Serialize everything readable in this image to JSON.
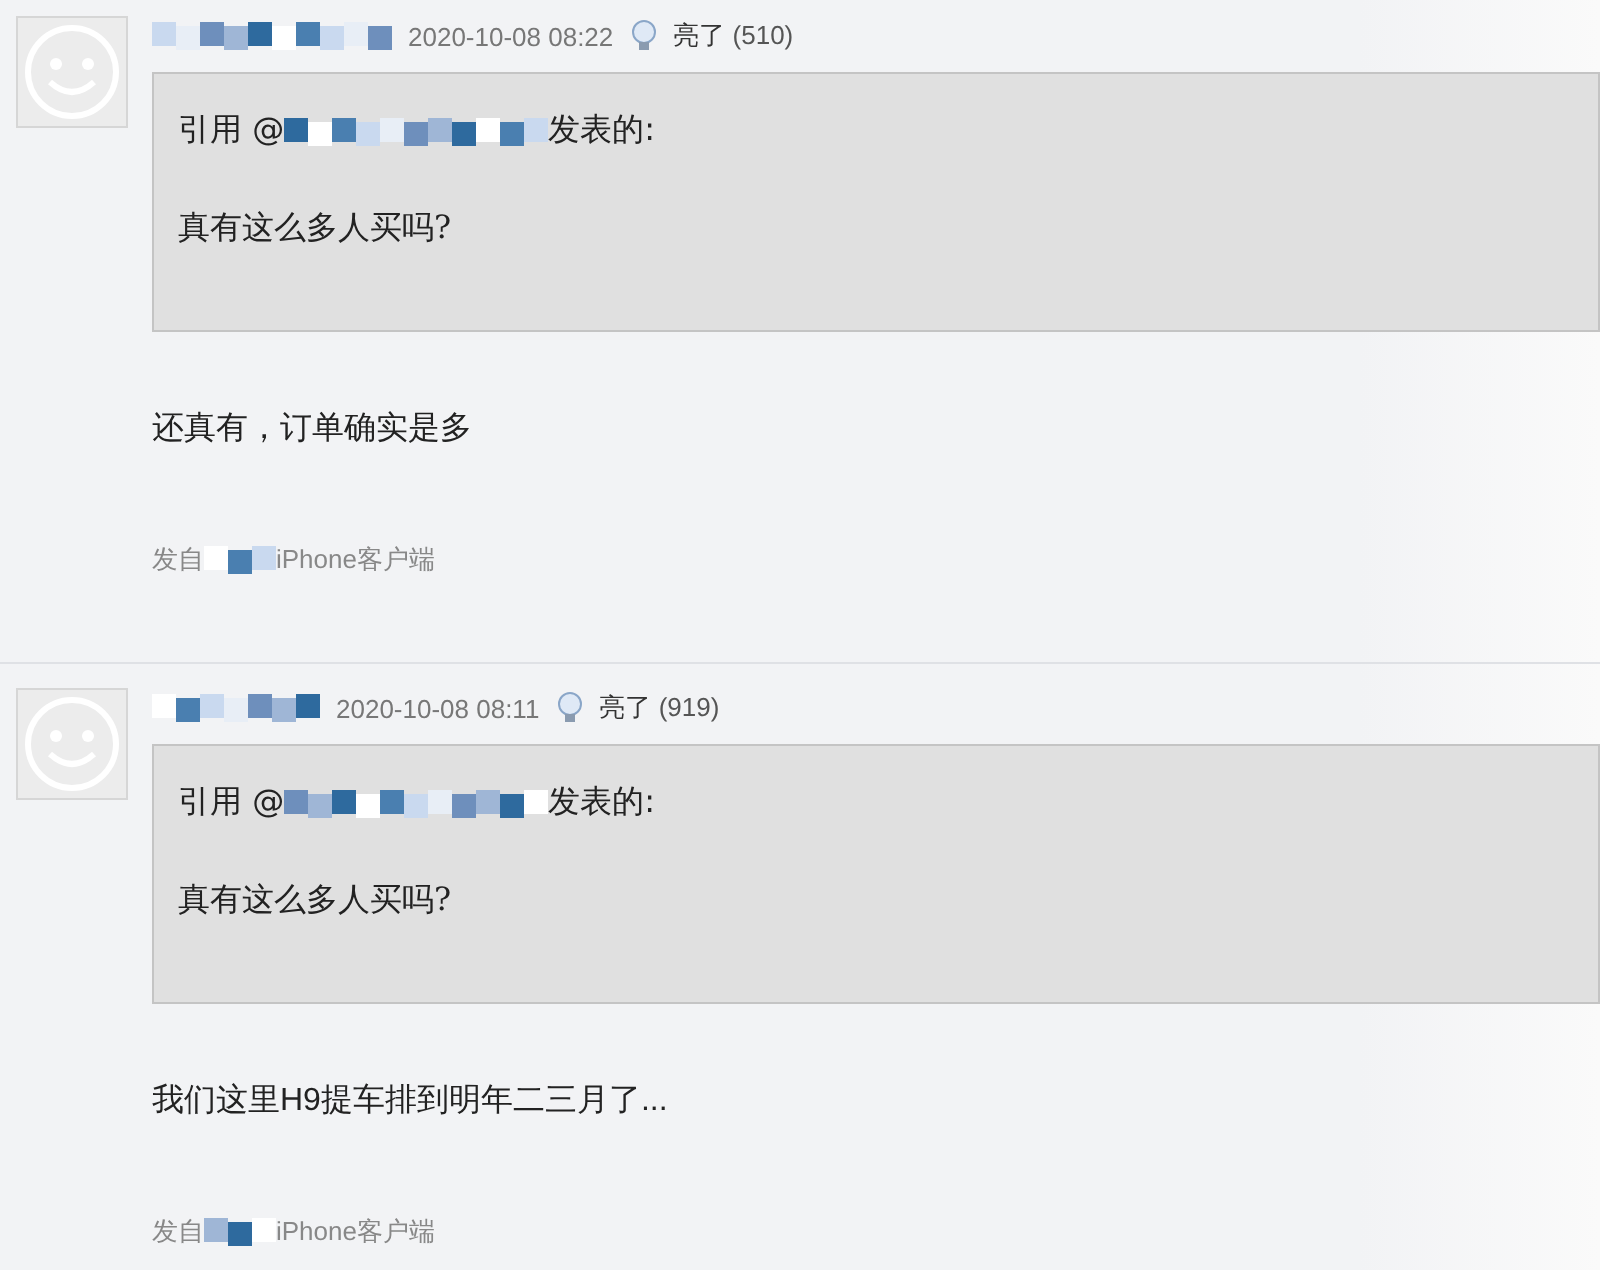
{
  "posts": [
    {
      "time": "2020-10-08 08:22",
      "like_label": "亮了",
      "like_count": "(510)",
      "quote": {
        "prefix": "引用 @",
        "suffix": "发表的:",
        "text": "真有这么多人买吗?"
      },
      "body": "还真有，订单确实是多",
      "source_prefix": "发自",
      "source_suffix": "iPhone客户端"
    },
    {
      "time": "2020-10-08 08:11",
      "like_label": "亮了",
      "like_count": "(919)",
      "quote": {
        "prefix": "引用 @",
        "suffix": "发表的:",
        "text": "真有这么多人买吗?"
      },
      "body": "我们这里H9提车排到明年二三月了...",
      "source_prefix": "发自",
      "source_suffix": "iPhone客户端"
    }
  ]
}
